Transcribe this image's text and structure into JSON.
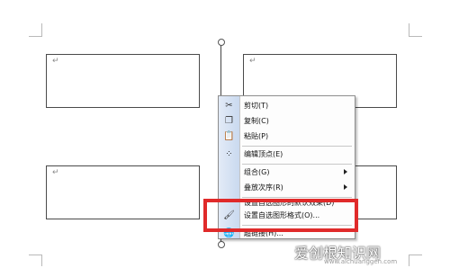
{
  "paragraph_mark": "↵",
  "menu": {
    "items": [
      {
        "label": "剪切(T)",
        "icon": "scissors-icon",
        "glyph": "✂"
      },
      {
        "label": "复制(C)",
        "icon": "copy-icon",
        "glyph": "❐"
      },
      {
        "label": "粘贴(P)",
        "icon": "paste-icon",
        "glyph": "📋"
      },
      {
        "label": "编辑顶点(E)",
        "icon": "edit-points-icon",
        "glyph": "⁘"
      },
      {
        "label": "组合(G)",
        "submenu": true
      },
      {
        "label": "叠放次序(R)",
        "submenu": true
      },
      {
        "label": "设置自选图形的默认效果(D)"
      },
      {
        "label": "设置自选图形格式(O)...",
        "icon": "format-shape-icon",
        "glyph": "🖌"
      },
      {
        "label": "超链接(H)...",
        "icon": "hyperlink-icon",
        "glyph": "🌐"
      }
    ]
  },
  "watermark": {
    "text": "爱创根知识网",
    "url": "www.aichuanggen.com"
  },
  "colors": {
    "highlight": "#e02a2a",
    "gutter": "#c9d9ef"
  }
}
